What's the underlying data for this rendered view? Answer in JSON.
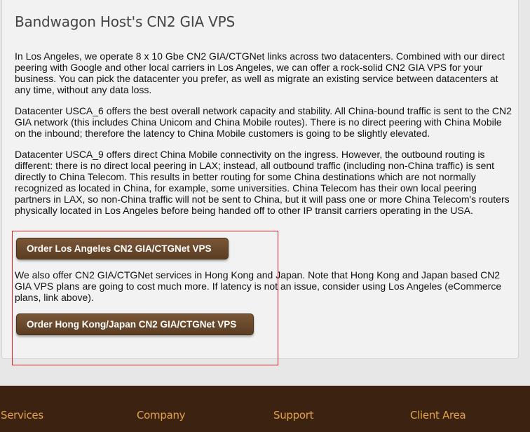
{
  "content": {
    "title": "Bandwagon Host's CN2 GIA VPS",
    "paragraphs": [
      "In Los Angeles, we operate 8 x 10 Gbe CN2 GIA/CTGNet links across two datacenters. Combined with our direct peering with Google and other local carriers in Los Angeles, we can offer a rock-solid CN2 GIA VPS for your business. You can pick the datacenter you prefer, as well as migrate an existing service between datacenters at any time, without any data loss.",
      "Datacenter USCA_6 offers the best overall network capacity and stability. All China-bound traffic is sent to the CN2 GIA network (this includes China Unicom and China Mobile routes). There is no direct peering with China Mobile on the inbound; therefore the latency to China Mobile customers is going to be slightly elevated.",
      "Datacenter USCA_9 offers direct China Mobile connectivity on the ingress. However, the outbound routing is different: there is no direct local peering in LAX; instead, all outbound traffic (including non-China traffic) is sent directly to China Telecom. This results in better routing for some China destinations which are not normally recognized as located in China, for example, some universities. China Telecom has their own local peering partners in LAX, so non-China traffic will not be sent to China, but it will pass one or more China Telecom's routers physically located in Los Angeles before being handed off to other IP transit carriers operating in the USA.",
      "We also offer CN2 GIA/CTGNet services in Hong Kong and Japan. Note that Hong Kong and Japan based CN2 GIA VPS plans are going to cost much more. If latency is not an issue, consider using Los Angeles (eCommerce plans, link above)."
    ],
    "buttons": {
      "order_la": "Order Los Angeles CN2 GIA/CTGNet VPS",
      "order_hk": "Order Hong Kong/Japan CN2 GIA/CTGNet VPS"
    }
  },
  "footer": {
    "links": [
      "Services",
      "Company",
      "Support",
      "Client Area"
    ]
  },
  "colors": {
    "button_brown": "#6b4a2e",
    "footer_bg": "#3c2311",
    "footer_link": "#e3a14b",
    "highlight_red": "#e02020"
  }
}
